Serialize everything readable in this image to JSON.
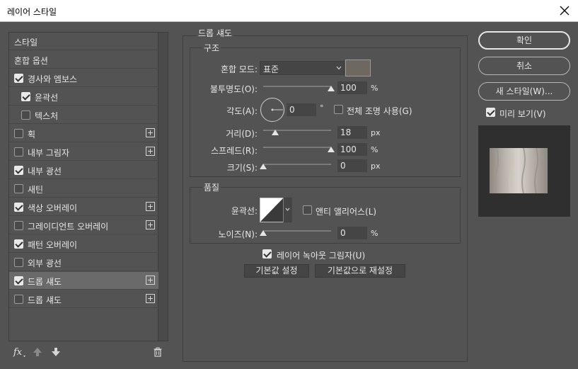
{
  "window": {
    "title": "레이어 스타일",
    "close_icon": "close-icon"
  },
  "styles": [
    {
      "label": "스타일",
      "checkbox": false,
      "checked": false,
      "plus": false,
      "selected": false
    },
    {
      "label": "혼합 옵션",
      "checkbox": false,
      "checked": false,
      "plus": false,
      "selected": false
    },
    {
      "label": "경사와 엠보스",
      "checkbox": true,
      "checked": true,
      "plus": false,
      "selected": false
    },
    {
      "label": "윤곽선",
      "checkbox": true,
      "checked": true,
      "plus": false,
      "selected": false,
      "indent": true
    },
    {
      "label": "텍스처",
      "checkbox": true,
      "checked": false,
      "plus": false,
      "selected": false,
      "indent": true
    },
    {
      "label": "획",
      "checkbox": true,
      "checked": false,
      "plus": true,
      "selected": false
    },
    {
      "label": "내부 그림자",
      "checkbox": true,
      "checked": false,
      "plus": true,
      "selected": false
    },
    {
      "label": "내부 광선",
      "checkbox": true,
      "checked": true,
      "plus": false,
      "selected": false
    },
    {
      "label": "새틴",
      "checkbox": true,
      "checked": false,
      "plus": false,
      "selected": false
    },
    {
      "label": "색상 오버레이",
      "checkbox": true,
      "checked": true,
      "plus": true,
      "selected": false
    },
    {
      "label": "그레이디언트 오버레이",
      "checkbox": true,
      "checked": false,
      "plus": true,
      "selected": false
    },
    {
      "label": "패턴 오버레이",
      "checkbox": true,
      "checked": true,
      "plus": false,
      "selected": false
    },
    {
      "label": "외부 광선",
      "checkbox": true,
      "checked": false,
      "plus": false,
      "selected": false
    },
    {
      "label": "드롭 섀도",
      "checkbox": true,
      "checked": true,
      "plus": true,
      "selected": true
    },
    {
      "label": "드롭 섀도",
      "checkbox": true,
      "checked": false,
      "plus": true,
      "selected": false
    }
  ],
  "bottom_icons": [
    "fx-icon",
    "move-up-icon",
    "move-down-icon",
    "trash-icon"
  ],
  "panel": {
    "title": "드롭 섀도",
    "structure": {
      "title": "구조",
      "blend_mode_label": "혼합 모드:",
      "blend_mode_value": "표준",
      "shadow_color": "#6e6860",
      "opacity_label": "불투명도(O):",
      "opacity_value": "100",
      "opacity_unit": "%",
      "opacity_level": 1.0,
      "angle_label": "각도(A):",
      "angle_value": "0",
      "angle_unit": "°",
      "global_light_label": "전체 조명 사용(G)",
      "global_light_checked": false,
      "distance_label": "거리(D):",
      "distance_value": "18",
      "distance_unit": "px",
      "distance_level": 0.18,
      "spread_label": "스프레드(R):",
      "spread_value": "100",
      "spread_unit": "%",
      "spread_level": 1.0,
      "size_label": "크기(S):",
      "size_value": "0",
      "size_unit": "px",
      "size_level": 0.0
    },
    "quality": {
      "title": "품질",
      "contour_label": "윤곽선:",
      "antialias_label": "앤티 앨리어스(L)",
      "antialias_checked": false,
      "noise_label": "노이즈(N):",
      "noise_value": "0",
      "noise_unit": "%",
      "noise_level": 0.0
    },
    "knockout_label": "레이어 녹아웃 그림자(U)",
    "knockout_checked": true,
    "make_default": "기본값 설정",
    "reset_default": "기본값으로 재설정"
  },
  "buttons": {
    "ok": "확인",
    "cancel": "취소",
    "new_style": "새 스타일(W)...",
    "preview_label": "미리 보기(V)",
    "preview_checked": true
  },
  "colors": {
    "background": "#535353",
    "field": "#454545",
    "selected_row": "#6a6a6a"
  }
}
